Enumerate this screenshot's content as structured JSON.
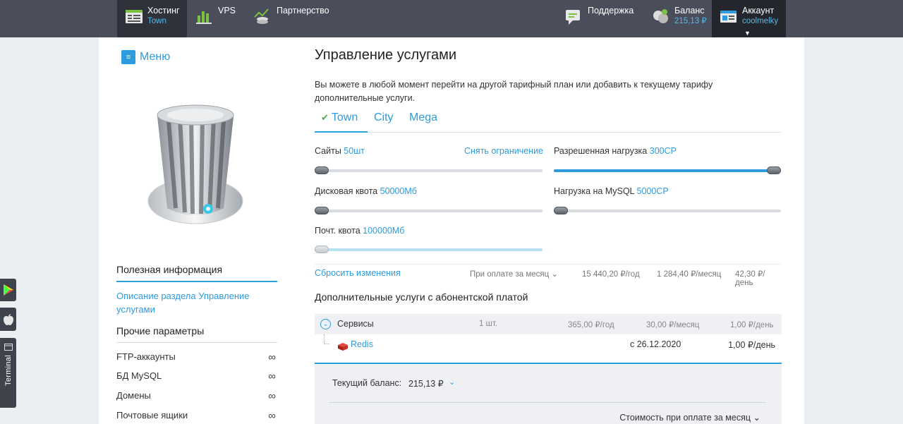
{
  "nav": {
    "hosting": {
      "label": "Хостинг",
      "sub": "Town"
    },
    "vps": {
      "label": "VPS"
    },
    "partner": {
      "label": "Партнерство"
    },
    "support": {
      "label": "Поддержка"
    },
    "balance": {
      "label": "Баланс",
      "sub": "215,13 ₽"
    },
    "account": {
      "label": "Аккаунт",
      "sub": "coolmelky"
    }
  },
  "sidebar": {
    "menu_label": "Меню",
    "info_title": "Полезная информация",
    "info_link": "Описание раздела Управление услугами",
    "other_title": "Прочие параметры",
    "params": [
      {
        "label": "FTP-аккаунты",
        "value": "∞"
      },
      {
        "label": "БД MySQL",
        "value": "∞"
      },
      {
        "label": "Домены",
        "value": "∞"
      },
      {
        "label": "Почтовые ящики",
        "value": "∞"
      }
    ]
  },
  "main": {
    "title": "Управление услугами",
    "description": "Вы можете в любой момент перейти на другой тарифный план или добавить к текущему тарифу дополнительные услуги.",
    "tabs": [
      {
        "label": "Town",
        "active": true
      },
      {
        "label": "City",
        "active": false
      },
      {
        "label": "Mega",
        "active": false
      }
    ],
    "sliders": {
      "sites": {
        "label": "Сайты",
        "value": "50шт",
        "action": "Снять ограничение",
        "level": 0
      },
      "load": {
        "label": "Разрешенная нагрузка",
        "value": "300CP",
        "level": 1
      },
      "disk": {
        "label": "Дисковая квота",
        "value": "50000Мб",
        "level": 0
      },
      "mysql": {
        "label": "Нагрузка на MySQL",
        "value": "5000CP",
        "level": 0
      },
      "mail": {
        "label": "Почт. квота",
        "value": "100000Мб",
        "level": 0
      }
    },
    "summary": {
      "reset": "Сбросить изменения",
      "period": "При оплате за месяц",
      "per_year": "15 440,20 ₽/год",
      "per_month": "1 284,40 ₽/месяц",
      "per_day": "42,30 ₽/день"
    },
    "addons": {
      "title": "Дополнительные услуги с абонентской платой",
      "group": {
        "name": "Сервисы",
        "count": "1 шт.",
        "per_year": "365,00 ₽/год",
        "per_month": "30,00 ₽/месяц",
        "per_day": "1,00 ₽/день"
      },
      "items": [
        {
          "name": "Redis",
          "since": "с 26.12.2020",
          "price": "1,00 ₽/день"
        }
      ]
    },
    "balance": {
      "label": "Текущий баланс:",
      "value": "215,13 ₽",
      "cost_period": "Стоимость при оплате за месяц"
    }
  },
  "side_widgets": {
    "terminal_label": "Terminal"
  },
  "colors": {
    "accent": "#2d9be0",
    "topbar": "#4a4e5b",
    "success": "#46b04a"
  }
}
